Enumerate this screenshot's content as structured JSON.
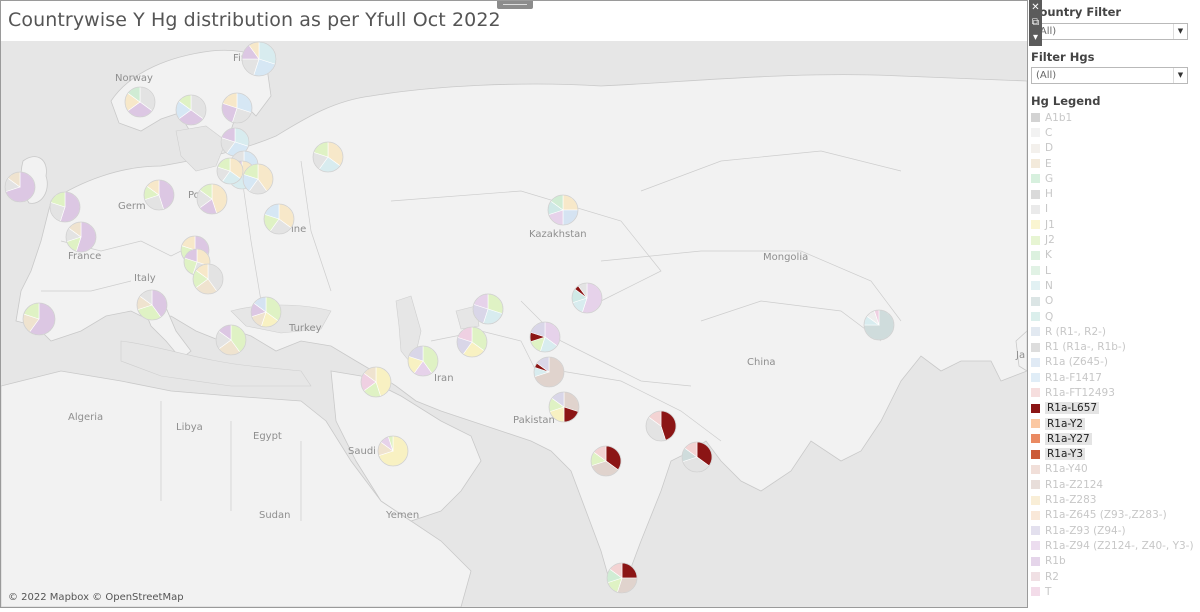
{
  "title": "Countrywise Y Hg distribution as per Yfull Oct 2022",
  "attribution": "© 2022 Mapbox © OpenStreetMap",
  "map": {
    "labels": [
      "Norway",
      "Fin",
      "Germ",
      "Po",
      "France",
      "Italy",
      "Turkey",
      "Kazakhstan",
      "Mongolia",
      "China",
      "Iran",
      "Pakistan",
      "Algeria",
      "Libya",
      "Egypt",
      "Saudi",
      "Sudan",
      "Yemen",
      "Ja",
      "ine"
    ]
  },
  "filters": {
    "country_label": "Country Filter",
    "country_value": "(All)",
    "hg_label": "Filter Hgs",
    "hg_value": "(All)",
    "legend_label": "Hg Legend"
  },
  "legend": [
    {
      "label": "A1b1",
      "color": "#c4c4c4",
      "hl": false
    },
    {
      "label": "C",
      "color": "#eeeeee",
      "hl": false
    },
    {
      "label": "D",
      "color": "#efebe5",
      "hl": false
    },
    {
      "label": "E",
      "color": "#efe3cf",
      "hl": false
    },
    {
      "label": "G",
      "color": "#c9ebd3",
      "hl": false
    },
    {
      "label": "H",
      "color": "#cdcdcd",
      "hl": false
    },
    {
      "label": "I",
      "color": "#e3e3e3",
      "hl": false
    },
    {
      "label": "J1",
      "color": "#f8f1c2",
      "hl": false
    },
    {
      "label": "J2",
      "color": "#dff2c4",
      "hl": false
    },
    {
      "label": "K",
      "color": "#d0ecd4",
      "hl": false
    },
    {
      "label": "L",
      "color": "#d7eedc",
      "hl": false
    },
    {
      "label": "N",
      "color": "#d8ecef",
      "hl": false
    },
    {
      "label": "O",
      "color": "#cfdcdc",
      "hl": false
    },
    {
      "label": "Q",
      "color": "#cfe9e6",
      "hl": false
    },
    {
      "label": "R (R1-, R2-)",
      "color": "#d8e1ec",
      "hl": false
    },
    {
      "label": "R1 (R1a-, R1b-)",
      "color": "#d2d2d2",
      "hl": false
    },
    {
      "label": "R1a (Z645-)",
      "color": "#d5e3f2",
      "hl": false
    },
    {
      "label": "R1a-F1417",
      "color": "#d6e7f4",
      "hl": false
    },
    {
      "label": "R1a-FT12493",
      "color": "#f3d3d3",
      "hl": false
    },
    {
      "label": "R1a-L657",
      "color": "#8b1515",
      "hl": true
    },
    {
      "label": "R1a-Y2",
      "color": "#fbc8a2",
      "hl": true
    },
    {
      "label": "R1a-Y27",
      "color": "#ea8a62",
      "hl": true
    },
    {
      "label": "R1a-Y3",
      "color": "#cb5a37",
      "hl": true
    },
    {
      "label": "R1a-Y40",
      "color": "#ecd4cc",
      "hl": false
    },
    {
      "label": "R1a-Z2124",
      "color": "#e0d3cd",
      "hl": false
    },
    {
      "label": "R1a-Z283",
      "color": "#f7e8c9",
      "hl": false
    },
    {
      "label": "R1a-Z645 (Z93-,Z283-)",
      "color": "#f7e0cc",
      "hl": false
    },
    {
      "label": "R1a-Z93 (Z94-)",
      "color": "#d9d6e8",
      "hl": false
    },
    {
      "label": "R1a-Z94 (Z2124-, Z40-, Y3-)",
      "color": "#e6d2ea",
      "hl": false
    },
    {
      "label": "R1b",
      "color": "#dcc7e3",
      "hl": false
    },
    {
      "label": "R2",
      "color": "#ebd6db",
      "hl": false
    },
    {
      "label": "T",
      "color": "#efd0e2",
      "hl": false
    }
  ],
  "pies": [
    {
      "name": "finland",
      "slices": [
        {
          "v": 30,
          "c": "#d8ecef"
        },
        {
          "v": 25,
          "c": "#d6e7f4"
        },
        {
          "v": 20,
          "c": "#e3e3e3"
        },
        {
          "v": 15,
          "c": "#dcc7e3"
        },
        {
          "v": 10,
          "c": "#f7e8c9"
        }
      ]
    },
    {
      "name": "norway",
      "slices": [
        {
          "v": 35,
          "c": "#e3e3e3"
        },
        {
          "v": 30,
          "c": "#dcc7e3"
        },
        {
          "v": 20,
          "c": "#f7e8c9"
        },
        {
          "v": 15,
          "c": "#d0ecd4"
        }
      ]
    },
    {
      "name": "sweden",
      "slices": [
        {
          "v": 35,
          "c": "#e3e3e3"
        },
        {
          "v": 30,
          "c": "#dcc7e3"
        },
        {
          "v": 20,
          "c": "#d6e7f4"
        },
        {
          "v": 15,
          "c": "#dff2c4"
        }
      ]
    },
    {
      "name": "sweden-east",
      "slices": [
        {
          "v": 30,
          "c": "#d6e7f4"
        },
        {
          "v": 25,
          "c": "#e3e3e3"
        },
        {
          "v": 25,
          "c": "#dcc7e3"
        },
        {
          "v": 20,
          "c": "#f7e8c9"
        }
      ]
    },
    {
      "name": "estonia",
      "slices": [
        {
          "v": 30,
          "c": "#d8ecef"
        },
        {
          "v": 30,
          "c": "#d6e7f4"
        },
        {
          "v": 20,
          "c": "#e3e3e3"
        },
        {
          "v": 20,
          "c": "#dcc7e3"
        }
      ]
    },
    {
      "name": "latvia",
      "slices": [
        {
          "v": 35,
          "c": "#d6e7f4"
        },
        {
          "v": 25,
          "c": "#d8ecef"
        },
        {
          "v": 20,
          "c": "#f7e8c9"
        },
        {
          "v": 20,
          "c": "#e3e3e3"
        }
      ]
    },
    {
      "name": "lithuania",
      "slices": [
        {
          "v": 40,
          "c": "#f7e8c9"
        },
        {
          "v": 25,
          "c": "#d8ecef"
        },
        {
          "v": 20,
          "c": "#e3e3e3"
        },
        {
          "v": 15,
          "c": "#dcc7e3"
        }
      ]
    },
    {
      "name": "belarus",
      "slices": [
        {
          "v": 40,
          "c": "#f7e8c9"
        },
        {
          "v": 20,
          "c": "#e3e3e3"
        },
        {
          "v": 20,
          "c": "#d6e7f4"
        },
        {
          "v": 20,
          "c": "#dff2c4"
        }
      ]
    },
    {
      "name": "russia-west",
      "slices": [
        {
          "v": 35,
          "c": "#f7e8c9"
        },
        {
          "v": 25,
          "c": "#d8ecef"
        },
        {
          "v": 20,
          "c": "#e3e3e3"
        },
        {
          "v": 20,
          "c": "#dff2c4"
        }
      ]
    },
    {
      "name": "britain",
      "slices": [
        {
          "v": 70,
          "c": "#dcc7e3"
        },
        {
          "v": 15,
          "c": "#e3e3e3"
        },
        {
          "v": 15,
          "c": "#efe3cf"
        }
      ]
    },
    {
      "name": "netherlands",
      "slices": [
        {
          "v": 55,
          "c": "#dcc7e3"
        },
        {
          "v": 25,
          "c": "#e3e3e3"
        },
        {
          "v": 20,
          "c": "#dff2c4"
        }
      ]
    },
    {
      "name": "germany",
      "slices": [
        {
          "v": 45,
          "c": "#dcc7e3"
        },
        {
          "v": 25,
          "c": "#e3e3e3"
        },
        {
          "v": 15,
          "c": "#dff2c4"
        },
        {
          "v": 15,
          "c": "#f7e8c9"
        }
      ]
    },
    {
      "name": "poland",
      "slices": [
        {
          "v": 45,
          "c": "#f7e8c9"
        },
        {
          "v": 20,
          "c": "#dcc7e3"
        },
        {
          "v": 20,
          "c": "#e3e3e3"
        },
        {
          "v": 15,
          "c": "#dff2c4"
        }
      ]
    },
    {
      "name": "ukraine",
      "slices": [
        {
          "v": 35,
          "c": "#f7e8c9"
        },
        {
          "v": 25,
          "c": "#e3e3e3"
        },
        {
          "v": 20,
          "c": "#dff2c4"
        },
        {
          "v": 20,
          "c": "#d6e7f4"
        }
      ]
    },
    {
      "name": "russia-central",
      "slices": [
        {
          "v": 35,
          "c": "#f7e8c9"
        },
        {
          "v": 25,
          "c": "#d8ecef"
        },
        {
          "v": 20,
          "c": "#e3e3e3"
        },
        {
          "v": 20,
          "c": "#dff2c4"
        }
      ]
    },
    {
      "name": "france",
      "slices": [
        {
          "v": 55,
          "c": "#dcc7e3"
        },
        {
          "v": 15,
          "c": "#dff2c4"
        },
        {
          "v": 15,
          "c": "#e3e3e3"
        },
        {
          "v": 15,
          "c": "#efe3cf"
        }
      ]
    },
    {
      "name": "austria",
      "slices": [
        {
          "v": 30,
          "c": "#dcc7e3"
        },
        {
          "v": 25,
          "c": "#e3e3e3"
        },
        {
          "v": 25,
          "c": "#dff2c4"
        },
        {
          "v": 20,
          "c": "#f7e8c9"
        }
      ]
    },
    {
      "name": "hungary",
      "slices": [
        {
          "v": 30,
          "c": "#f7e8c9"
        },
        {
          "v": 25,
          "c": "#e3e3e3"
        },
        {
          "v": 25,
          "c": "#dff2c4"
        },
        {
          "v": 20,
          "c": "#dcc7e3"
        }
      ]
    },
    {
      "name": "serbia",
      "slices": [
        {
          "v": 40,
          "c": "#e3e3e3"
        },
        {
          "v": 25,
          "c": "#efe3cf"
        },
        {
          "v": 20,
          "c": "#dff2c4"
        },
        {
          "v": 15,
          "c": "#f7e8c9"
        }
      ]
    },
    {
      "name": "italy",
      "slices": [
        {
          "v": 40,
          "c": "#dcc7e3"
        },
        {
          "v": 30,
          "c": "#dff2c4"
        },
        {
          "v": 15,
          "c": "#efe3cf"
        },
        {
          "v": 15,
          "c": "#e3e3e3"
        }
      ]
    },
    {
      "name": "greece",
      "slices": [
        {
          "v": 40,
          "c": "#dff2c4"
        },
        {
          "v": 25,
          "c": "#efe3cf"
        },
        {
          "v": 20,
          "c": "#e3e3e3"
        },
        {
          "v": 15,
          "c": "#dcc7e3"
        }
      ]
    },
    {
      "name": "spain",
      "slices": [
        {
          "v": 60,
          "c": "#dcc7e3"
        },
        {
          "v": 20,
          "c": "#efe3cf"
        },
        {
          "v": 20,
          "c": "#dff2c4"
        }
      ]
    },
    {
      "name": "turkey",
      "slices": [
        {
          "v": 35,
          "c": "#dff2c4"
        },
        {
          "v": 20,
          "c": "#f8f1c2"
        },
        {
          "v": 15,
          "c": "#efe3cf"
        },
        {
          "v": 15,
          "c": "#dcc7e3"
        },
        {
          "v": 15,
          "c": "#d5e3f2"
        }
      ]
    },
    {
      "name": "caucasus",
      "slices": [
        {
          "v": 40,
          "c": "#dff2c4"
        },
        {
          "v": 20,
          "c": "#e6d2ea"
        },
        {
          "v": 20,
          "c": "#f8f1c2"
        },
        {
          "v": 20,
          "c": "#d9d6e8"
        }
      ]
    },
    {
      "name": "iraq",
      "slices": [
        {
          "v": 45,
          "c": "#f8f1c2"
        },
        {
          "v": 20,
          "c": "#dff2c4"
        },
        {
          "v": 20,
          "c": "#efd0e2"
        },
        {
          "v": 15,
          "c": "#efe3cf"
        }
      ]
    },
    {
      "name": "iran",
      "slices": [
        {
          "v": 35,
          "c": "#dff2c4"
        },
        {
          "v": 25,
          "c": "#f8f1c2"
        },
        {
          "v": 20,
          "c": "#d9d6e8"
        },
        {
          "v": 20,
          "c": "#efd0e2"
        }
      ]
    },
    {
      "name": "saudi",
      "slices": [
        {
          "v": 70,
          "c": "#f8f1c2"
        },
        {
          "v": 15,
          "c": "#efe3cf"
        },
        {
          "v": 10,
          "c": "#e6d2ea"
        },
        {
          "v": 5,
          "c": "#dff2c4"
        }
      ]
    },
    {
      "name": "turkmenistan",
      "slices": [
        {
          "v": 30,
          "c": "#d5e3f2"
        },
        {
          "v": 25,
          "c": "#dff2c4"
        },
        {
          "v": 25,
          "c": "#d9d6e8"
        },
        {
          "v": 20,
          "c": "#efd0e2"
        }
      ]
    },
    {
      "name": "uzbekistan",
      "slices": [
        {
          "v": 30,
          "c": "#dff2c4"
        },
        {
          "v": 25,
          "c": "#d8ecef"
        },
        {
          "v": 25,
          "c": "#d9d6e8"
        },
        {
          "v": 20,
          "c": "#e6d2ea"
        }
      ]
    },
    {
      "name": "kazakhstan",
      "slices": [
        {
          "v": 25,
          "c": "#f7e8c9"
        },
        {
          "v": 25,
          "c": "#d5e3f2"
        },
        {
          "v": 20,
          "c": "#e6d2ea"
        },
        {
          "v": 15,
          "c": "#cfe9e6"
        },
        {
          "v": 15,
          "c": "#d0ecd4"
        }
      ]
    },
    {
      "name": "kyrgyzstan",
      "slices": [
        {
          "v": 55,
          "c": "#e6d2ea"
        },
        {
          "v": 15,
          "c": "#d8ecef"
        },
        {
          "v": 15,
          "c": "#cfe9e6"
        },
        {
          "v": 5,
          "c": "#8b1515"
        },
        {
          "v": 10,
          "c": "#e3e3e3"
        }
      ]
    },
    {
      "name": "tajikistan",
      "slices": [
        {
          "v": 35,
          "c": "#e6d2ea"
        },
        {
          "v": 20,
          "c": "#d8ecef"
        },
        {
          "v": 15,
          "c": "#dff2c4"
        },
        {
          "v": 10,
          "c": "#8b1515"
        },
        {
          "v": 20,
          "c": "#d9d6e8"
        }
      ]
    },
    {
      "name": "afghanistan",
      "slices": [
        {
          "v": 70,
          "c": "#e0d3cd"
        },
        {
          "v": 10,
          "c": "#d8ecef"
        },
        {
          "v": 5,
          "c": "#8b1515"
        },
        {
          "v": 15,
          "c": "#d9d6e8"
        }
      ]
    },
    {
      "name": "pakistan",
      "slices": [
        {
          "v": 30,
          "c": "#e0d3cd"
        },
        {
          "v": 20,
          "c": "#8b1515"
        },
        {
          "v": 20,
          "c": "#f8f1c2"
        },
        {
          "v": 15,
          "c": "#dff2c4"
        },
        {
          "v": 15,
          "c": "#d9d6e8"
        }
      ]
    },
    {
      "name": "north-india",
      "slices": [
        {
          "v": 45,
          "c": "#8b1515"
        },
        {
          "v": 40,
          "c": "#e3e3e3"
        },
        {
          "v": 15,
          "c": "#f3d3d3"
        }
      ]
    },
    {
      "name": "west-india",
      "slices": [
        {
          "v": 35,
          "c": "#8b1515"
        },
        {
          "v": 35,
          "c": "#e0d3cd"
        },
        {
          "v": 15,
          "c": "#dff2c4"
        },
        {
          "v": 15,
          "c": "#f3d3d3"
        }
      ]
    },
    {
      "name": "bangladesh",
      "slices": [
        {
          "v": 35,
          "c": "#8b1515"
        },
        {
          "v": 35,
          "c": "#e3e3e3"
        },
        {
          "v": 15,
          "c": "#cfdcdc"
        },
        {
          "v": 15,
          "c": "#f3d3d3"
        }
      ]
    },
    {
      "name": "south-india",
      "slices": [
        {
          "v": 25,
          "c": "#8b1515"
        },
        {
          "v": 30,
          "c": "#e0d3cd"
        },
        {
          "v": 15,
          "c": "#dff2c4"
        },
        {
          "v": 15,
          "c": "#d0ecd4"
        },
        {
          "v": 15,
          "c": "#f3d3d3"
        }
      ]
    },
    {
      "name": "china-northeast",
      "slices": [
        {
          "v": 75,
          "c": "#cfdcdc"
        },
        {
          "v": 10,
          "c": "#d8ecef"
        },
        {
          "v": 10,
          "c": "#eeeeee"
        },
        {
          "v": 5,
          "c": "#efd0e2"
        }
      ]
    }
  ]
}
